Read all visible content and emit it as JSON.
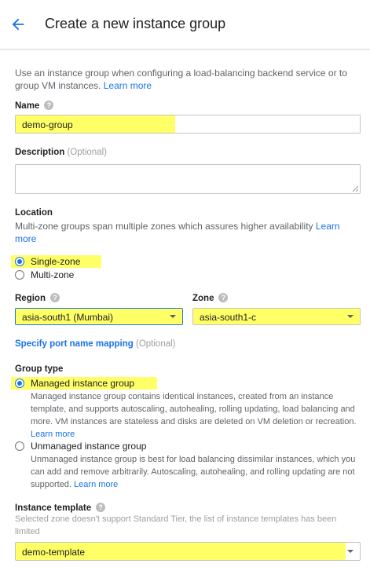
{
  "header": {
    "title": "Create a new instance group",
    "back_icon": "arrow-left-icon"
  },
  "intro": {
    "text": "Use an instance group when configuring a load-balancing backend service or to group VM instances.",
    "link": "Learn more"
  },
  "name": {
    "label": "Name",
    "value": "demo-group"
  },
  "description": {
    "label": "Description",
    "optional": "(Optional)",
    "value": ""
  },
  "location": {
    "title": "Location",
    "desc": "Multi-zone groups span multiple zones which assures higher availability",
    "link": "Learn more",
    "options": [
      {
        "label": "Single-zone",
        "selected": true
      },
      {
        "label": "Multi-zone",
        "selected": false
      }
    ]
  },
  "region": {
    "label": "Region",
    "value": "asia-south1 (Mumbai)"
  },
  "zone": {
    "label": "Zone",
    "value": "asia-south1-c"
  },
  "port_mapping": {
    "label": "Specify port name mapping",
    "optional": "(Optional)"
  },
  "group_type": {
    "title": "Group type",
    "managed": {
      "label": "Managed instance group",
      "desc": "Managed instance group contains identical instances, created from an instance template, and supports autoscaling, autohealing, rolling updating, load balancing and more. VM instances are stateless and disks are deleted on VM deletion or recreation.",
      "link": "Learn more",
      "selected": true
    },
    "unmanaged": {
      "label": "Unmanaged instance group",
      "desc": "Unmanaged instance group is best for load balancing dissimilar instances, which you can add and remove arbitrarily. Autoscaling, autohealing, and rolling updating are not supported.",
      "link": "Learn more",
      "selected": false
    }
  },
  "instance_template": {
    "label": "Instance template",
    "note": "Selected zone doesn't support Standard Tier, the list of instance templates has been limited",
    "value": "demo-template"
  },
  "colors": {
    "accent": "#1a73e8",
    "highlight": "#ffff66"
  }
}
